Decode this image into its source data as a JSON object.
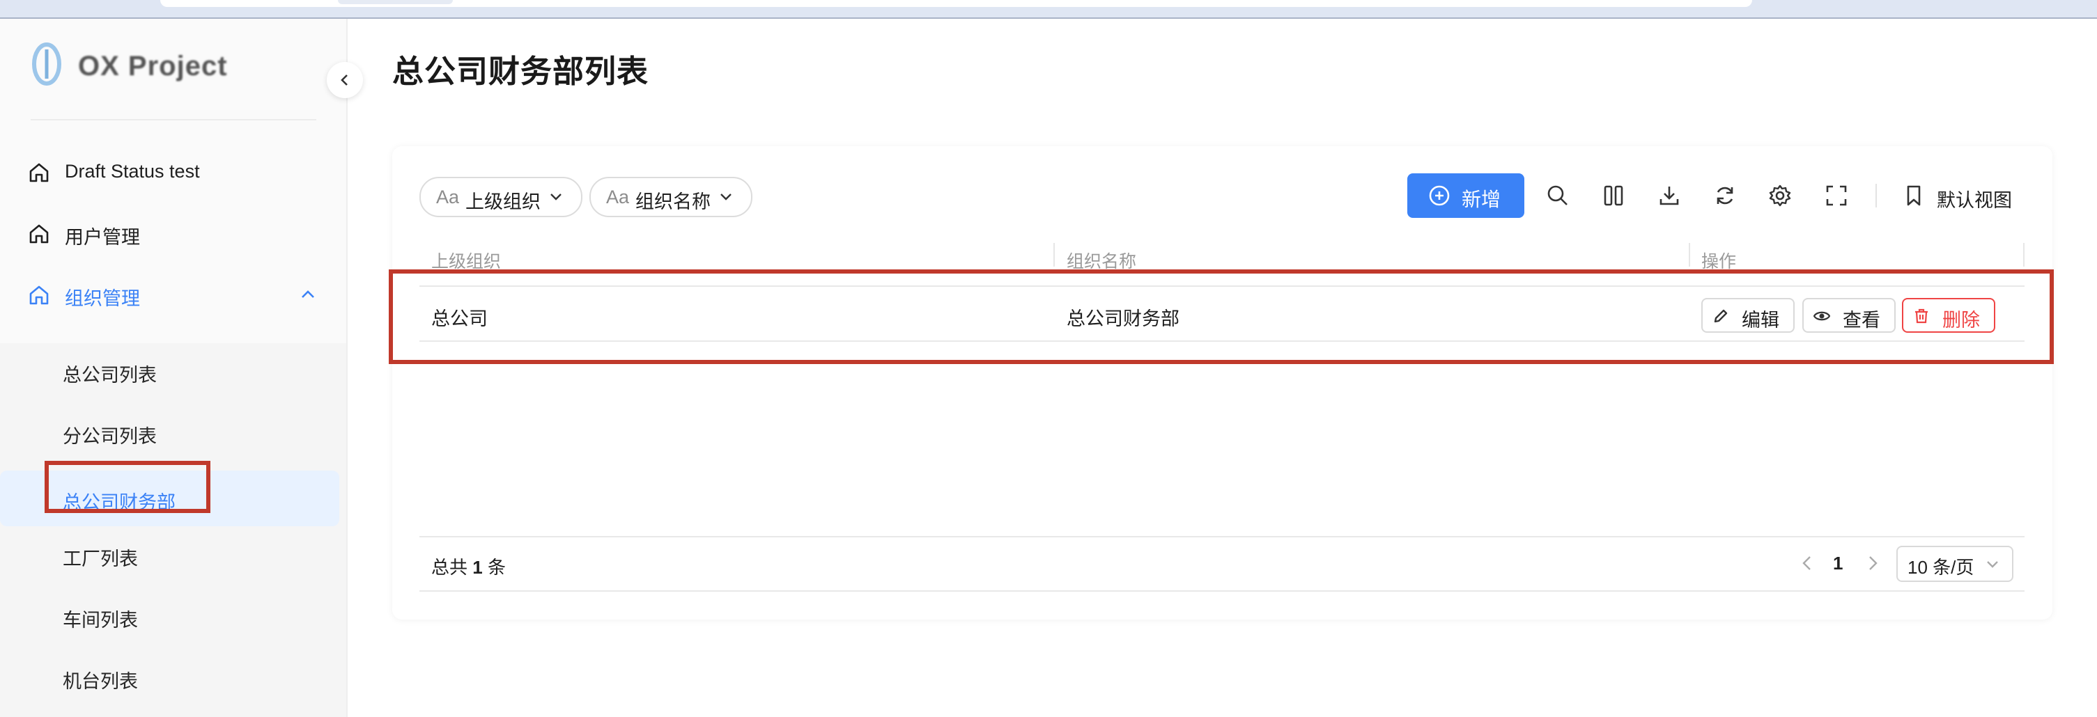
{
  "app": {
    "brand_name": "OX Project",
    "colors": {
      "accent": "#3b82f6",
      "danger": "#ef4444",
      "highlight": "#c0392b"
    }
  },
  "sidebar": {
    "items": [
      {
        "label": "Draft Status test",
        "icon": "home-icon"
      },
      {
        "label": "用户管理",
        "icon": "home-icon"
      },
      {
        "label": "组织管理",
        "icon": "home-icon",
        "expanded": true
      }
    ],
    "sub_items": [
      {
        "label": "总公司列表"
      },
      {
        "label": "分公司列表"
      },
      {
        "label": "总公司财务部",
        "selected": true
      },
      {
        "label": "工厂列表"
      },
      {
        "label": "车间列表"
      },
      {
        "label": "机台列表"
      }
    ]
  },
  "page": {
    "title": "总公司财务部列表"
  },
  "filters": [
    {
      "prefix": "Aa",
      "label": "上级组织"
    },
    {
      "prefix": "Aa",
      "label": "组织名称"
    }
  ],
  "toolbar": {
    "new_label": "新增",
    "icons": [
      "search-icon",
      "columns-icon",
      "download-icon",
      "refresh-icon",
      "settings-icon",
      "fullscreen-icon"
    ],
    "view_label": "默认视图"
  },
  "table": {
    "columns": [
      "上级组织",
      "组织名称",
      "操作"
    ],
    "rows": [
      {
        "parent": "总公司",
        "name": "总公司财务部"
      }
    ],
    "actions": {
      "edit": "编辑",
      "view": "查看",
      "delete": "删除"
    }
  },
  "pagination": {
    "total_prefix": "总共",
    "total_count": "1",
    "total_suffix": "条",
    "current_page": "1",
    "page_size": "10 条/页"
  }
}
